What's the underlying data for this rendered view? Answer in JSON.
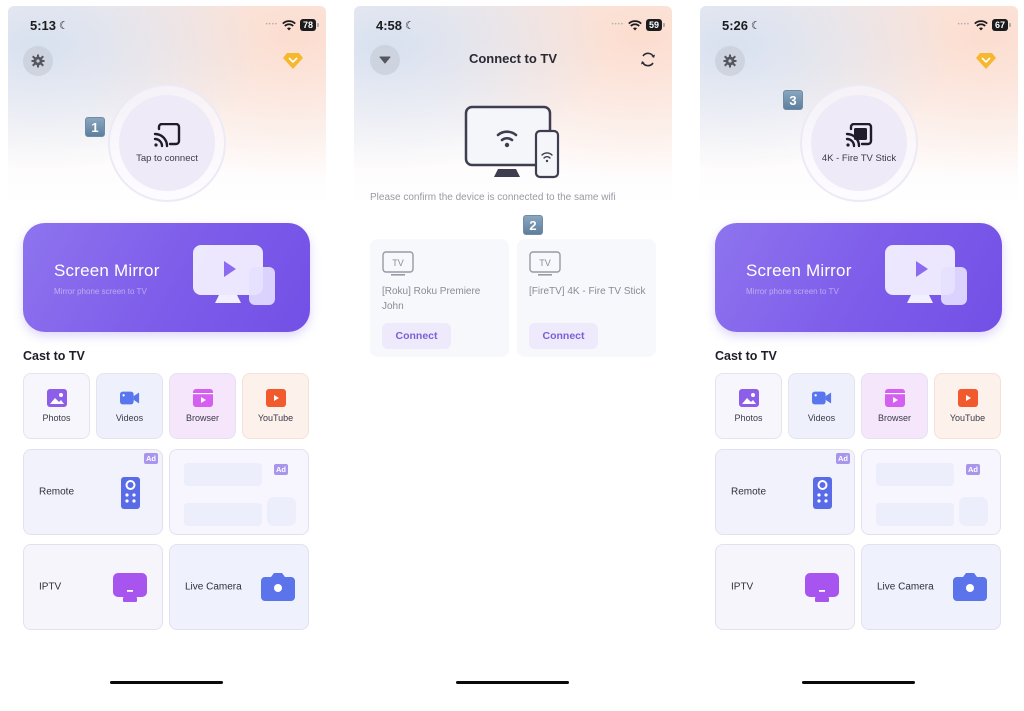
{
  "screens": [
    {
      "status": {
        "time": "5:13",
        "battery": "78"
      },
      "step_badge": "1",
      "connect_label": "Tap to connect",
      "mirror": {
        "title": "Screen Mirror",
        "subtitle": "Mirror phone screen to TV"
      },
      "section_title": "Cast to TV",
      "tiles": [
        {
          "label": "Photos",
          "icon": "photos-icon"
        },
        {
          "label": "Videos",
          "icon": "video-camera-icon"
        },
        {
          "label": "Browser",
          "icon": "browser-icon"
        },
        {
          "label": "YouTube",
          "icon": "youtube-icon"
        }
      ],
      "features": [
        {
          "label": "Remote",
          "badge": "Ad",
          "icon": "remote-icon"
        },
        {
          "label": "",
          "badge": "Ad",
          "icon": "ad-placeholder"
        },
        {
          "label": "IPTV",
          "icon": "tv-icon"
        },
        {
          "label": "Live Camera",
          "icon": "camera-icon"
        }
      ]
    },
    {
      "status": {
        "time": "4:58",
        "battery": "59"
      },
      "header_title": "Connect to TV",
      "hint": "Please confirm the device is connected to the same wifi",
      "step_badge": "2",
      "devices": [
        {
          "tv_label": "TV",
          "name": "[Roku] Roku Premiere John",
          "action": "Connect"
        },
        {
          "tv_label": "TV",
          "name": "[FireTV] 4K - Fire TV Stick",
          "action": "Connect"
        }
      ]
    },
    {
      "status": {
        "time": "5:26",
        "battery": "67"
      },
      "step_badge": "3",
      "connect_label": "4K - Fire TV Stick",
      "mirror": {
        "title": "Screen Mirror",
        "subtitle": "Mirror phone screen to TV"
      },
      "section_title": "Cast to TV",
      "tiles": [
        {
          "label": "Photos",
          "icon": "photos-icon"
        },
        {
          "label": "Videos",
          "icon": "video-camera-icon"
        },
        {
          "label": "Browser",
          "icon": "browser-icon"
        },
        {
          "label": "YouTube",
          "icon": "youtube-icon"
        }
      ],
      "features": [
        {
          "label": "Remote",
          "badge": "Ad",
          "icon": "remote-icon"
        },
        {
          "label": "",
          "badge": "Ad",
          "icon": "ad-placeholder"
        },
        {
          "label": "IPTV",
          "icon": "tv-icon"
        },
        {
          "label": "Live Camera",
          "icon": "camera-icon"
        }
      ]
    }
  ],
  "colors": {
    "accent_purple": "#7d5cea",
    "step_badge": "#6e8ca8",
    "gem": "#f5b82e",
    "photos": "#8d5ee8",
    "videos": "#5a76ee",
    "browser": "#d45ff0",
    "youtube": "#f05a2c"
  }
}
